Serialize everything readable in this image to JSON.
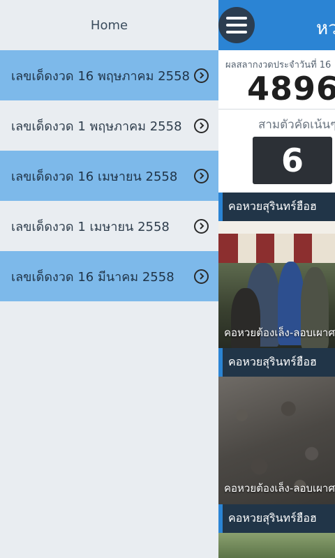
{
  "drawer": {
    "home_label": "Home",
    "items": [
      {
        "label": "เลขเด็ดงวด 16 พฤษภาคม 2558",
        "highlighted": true
      },
      {
        "label": "เลขเด็ดงวด 1 พฤษภาคม 2558",
        "highlighted": false
      },
      {
        "label": "เลขเด็ดงวด 16 เมษายน 2558",
        "highlighted": true
      },
      {
        "label": "เลขเด็ดงวด 1 เมษายน 2558",
        "highlighted": false
      },
      {
        "label": "เลขเด็ดงวด 16 มีนาคม 2558",
        "highlighted": true
      }
    ],
    "item_icon": "chevron-right-circle-icon"
  },
  "main": {
    "title": "หว",
    "menu_icon": "hamburger-menu-icon",
    "result_date_label": "ผลสลากงวดประจำวันที่ 16",
    "result_number": "4896",
    "three_digit_label": "สามตัวคัดเน้นๆ",
    "highlight_digit": "6",
    "news": [
      {
        "heading": "คอหวยสุรินทร์ฮือฮ",
        "caption": "คอหวยต้องเล็ง-ลอบเผาศ"
      },
      {
        "heading": "คอหวยสุรินทร์ฮือฮ",
        "caption": "คอหวยต้องเล็ง-ลอบเผาศ"
      },
      {
        "heading": "คอหวยสุรินทร์ฮือฮ",
        "caption": ""
      }
    ]
  },
  "colors": {
    "topbar": "#2b84d4",
    "highlight_row": "#7db9ea",
    "drawer_bg": "#e9edf1",
    "news_head": "#213548"
  }
}
